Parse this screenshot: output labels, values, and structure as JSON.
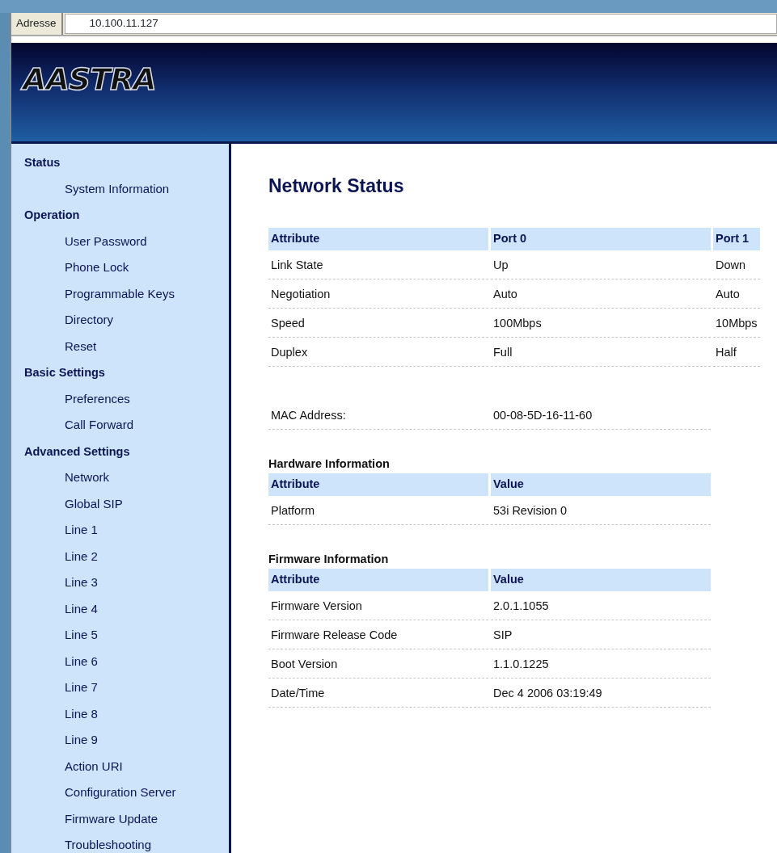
{
  "browser": {
    "address_label": "Adresse",
    "address": "10.100.11.127"
  },
  "header": {
    "logo": "AASTRA"
  },
  "sidebar": [
    {
      "heading": "Status",
      "items": [
        "System Information"
      ]
    },
    {
      "heading": "Operation",
      "items": [
        "User Password",
        "Phone Lock",
        "Programmable Keys",
        "Directory",
        "Reset"
      ]
    },
    {
      "heading": "Basic Settings",
      "items": [
        "Preferences",
        "Call Forward"
      ]
    },
    {
      "heading": "Advanced Settings",
      "items": [
        "Network",
        "Global SIP",
        "Line 1",
        "Line 2",
        "Line 3",
        "Line 4",
        "Line 5",
        "Line 6",
        "Line 7",
        "Line 8",
        "Line 9",
        "Action URI",
        "Configuration Server",
        "Firmware Update",
        "Troubleshooting"
      ]
    }
  ],
  "content": {
    "title": "Network Status",
    "sections": [
      {
        "kind": "table",
        "columns": [
          "Attribute",
          "Port 0",
          "Port 1"
        ],
        "rows": [
          [
            "Link State",
            "Up",
            "Down"
          ],
          [
            "Negotiation",
            "Auto",
            "Auto"
          ],
          [
            "Speed",
            "100Mbps",
            "10Mbps"
          ],
          [
            "Duplex",
            "Full",
            "Half"
          ]
        ]
      },
      {
        "kind": "pairs",
        "rows": [
          [
            "MAC Address:",
            "00-08-5D-16-11-60"
          ]
        ]
      },
      {
        "kind": "table",
        "heading": "Hardware Information",
        "columns": [
          "Attribute",
          "Value"
        ],
        "rows": [
          [
            "Platform",
            "53i Revision 0"
          ]
        ]
      },
      {
        "kind": "table",
        "heading": "Firmware Information",
        "columns": [
          "Attribute",
          "Value"
        ],
        "rows": [
          [
            "Firmware Version",
            "2.0.1.1055"
          ],
          [
            "Firmware Release Code",
            "SIP"
          ],
          [
            "Boot Version",
            "1.1.0.1225"
          ],
          [
            "Date/Time",
            "Dec 4 2006 03:19:49"
          ]
        ]
      }
    ]
  }
}
